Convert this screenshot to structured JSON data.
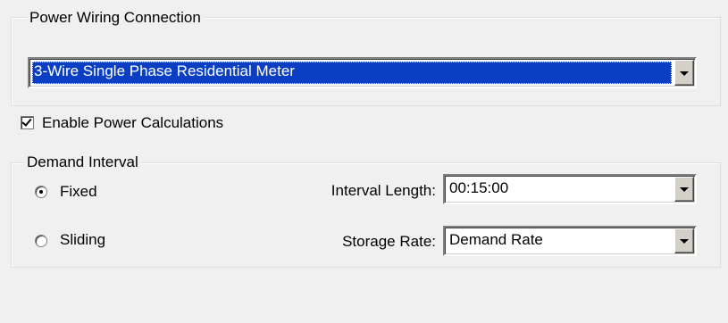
{
  "power_wiring": {
    "group_title": "Power Wiring Connection",
    "selected_value": "3-Wire Single Phase Residential Meter"
  },
  "enable_power": {
    "label": "Enable Power Calculations",
    "checked": true
  },
  "demand_interval": {
    "group_title": "Demand Interval",
    "fixed_label": "Fixed",
    "sliding_label": "Sliding",
    "selected_mode": "Fixed",
    "interval_length_label": "Interval Length:",
    "interval_length_value": "00:15:00",
    "storage_rate_label": "Storage Rate:",
    "storage_rate_value": "Demand Rate"
  },
  "icons": {
    "dropdown": "chevron-down-icon",
    "check": "checkmark-icon",
    "radio_selected": "radio-dot-icon"
  }
}
